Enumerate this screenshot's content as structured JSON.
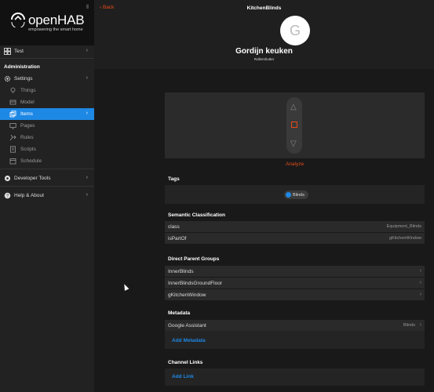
{
  "sidebar": {
    "logo_text": "openHAB",
    "logo_tagline": "empowering the smart home",
    "pin_icon": "pin-icon",
    "home_item": {
      "label": "Test",
      "icon": "grid-icon"
    },
    "admin_heading": "Administration",
    "items": [
      {
        "label": "Settings",
        "icon": "gear-icon",
        "chevron": "⌄"
      },
      {
        "label": "Things",
        "icon": "lightbulb-icon"
      },
      {
        "label": "Model",
        "icon": "model-icon"
      },
      {
        "label": "Items",
        "icon": "items-icon",
        "active": true
      },
      {
        "label": "Pages",
        "icon": "pages-icon"
      },
      {
        "label": "Rules",
        "icon": "rules-icon"
      },
      {
        "label": "Scripts",
        "icon": "scripts-icon"
      },
      {
        "label": "Schedule",
        "icon": "calendar-icon"
      }
    ],
    "developer_tools": {
      "label": "Developer Tools",
      "icon": "gear-icon"
    },
    "help": {
      "label": "Help & About",
      "icon": "help-icon"
    }
  },
  "topbar": {
    "back_label": "Back",
    "title": "KitchenBlinds",
    "avatar_letter": "G",
    "item_label": "Gordijn keuken",
    "item_type": "Rollershutter"
  },
  "widget": {
    "analyze_label": "Analyze"
  },
  "tags": {
    "title": "Tags",
    "chip": "Blinds"
  },
  "semantic": {
    "title": "Semantic Classification",
    "rows": [
      {
        "key": "class",
        "value": "Equipment_Blinds"
      },
      {
        "key": "isPartOf",
        "value": "gKitchenWindow"
      }
    ]
  },
  "parents": {
    "title": "Direct Parent Groups",
    "rows": [
      "InnerBlinds",
      "InnerBlindsGroundFloor",
      "gKitchenWindow"
    ]
  },
  "metadata": {
    "title": "Metadata",
    "row": {
      "key": "Google Assistant",
      "value": "Blinds"
    },
    "add_label": "Add Metadata"
  },
  "channels": {
    "title": "Channel Links",
    "add_label": "Add Link"
  },
  "colors": {
    "accent_orange": "#e64a19",
    "accent_blue": "#1e88e5"
  }
}
